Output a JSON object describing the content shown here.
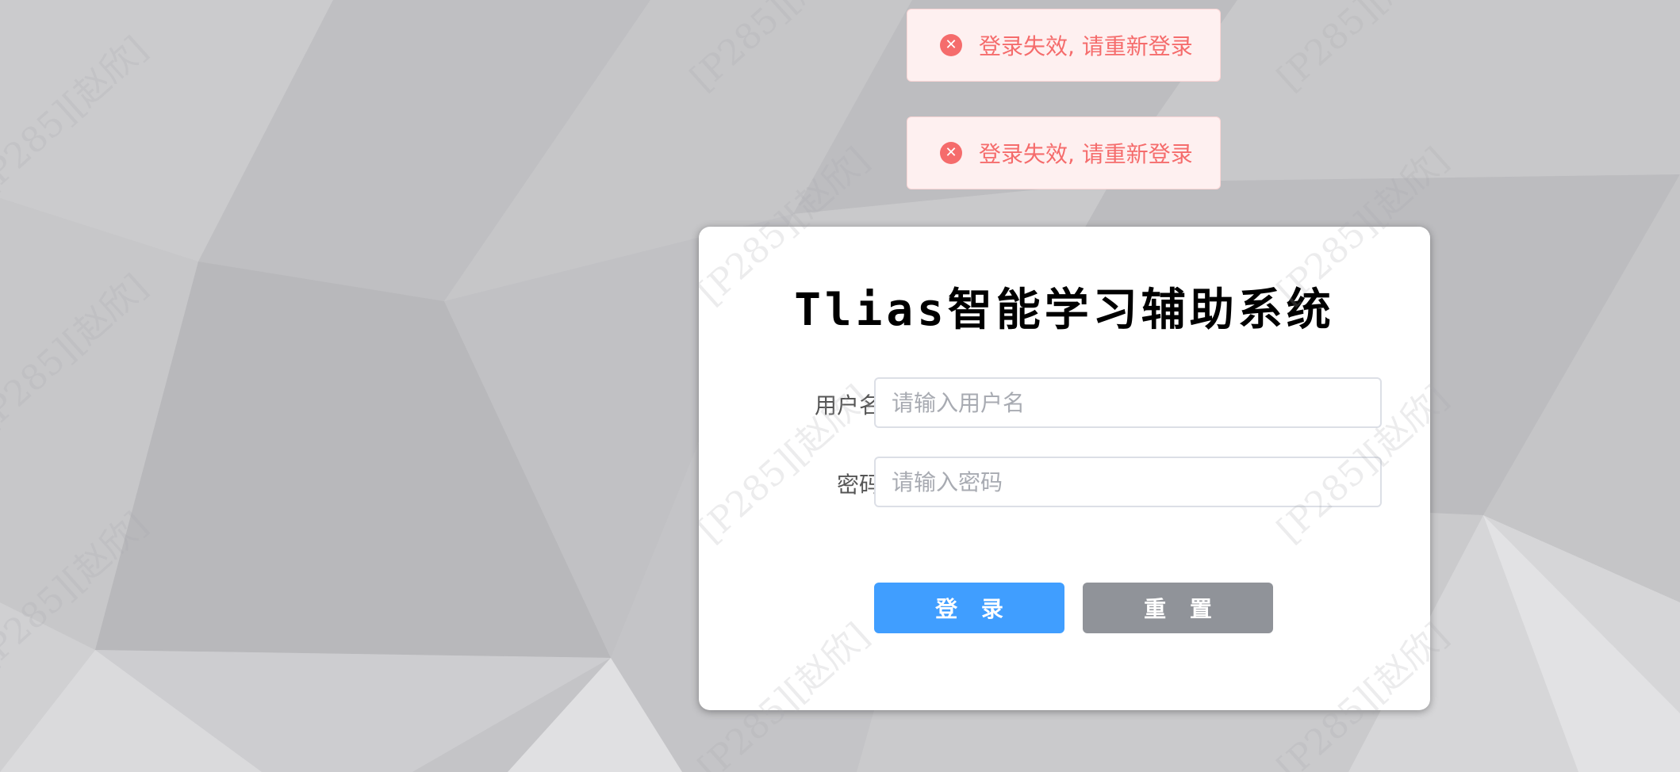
{
  "toasts": [
    {
      "icon": "error-circle-icon",
      "message": "登录失效, 请重新登录"
    },
    {
      "icon": "error-circle-icon",
      "message": "登录失效, 请重新登录"
    }
  ],
  "login": {
    "title": "Tlias智能学习辅助系统",
    "username": {
      "label": "用户名",
      "placeholder": "请输入用户名",
      "value": ""
    },
    "password": {
      "label": "密码",
      "placeholder": "请输入密码",
      "value": ""
    },
    "login_button": "登 录",
    "reset_button": "重 置"
  },
  "watermark": {
    "text": "[P285][赵欣]"
  },
  "colors": {
    "primary": "#409eff",
    "info": "#909399",
    "error": "#f56c6c",
    "error_bg": "#fef0f0"
  }
}
